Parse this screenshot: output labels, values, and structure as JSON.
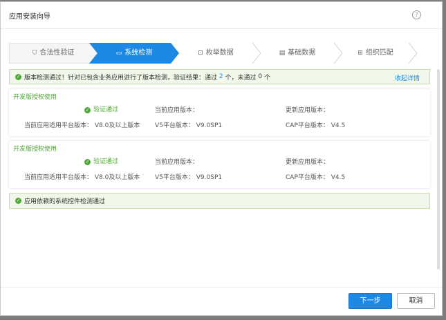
{
  "window": {
    "title": "应用安装向导"
  },
  "steps": [
    {
      "label": "合法性验证",
      "icon": "shield-icon"
    },
    {
      "label": "系统检测",
      "icon": "monitor-icon"
    },
    {
      "label": "枚举数据",
      "icon": "enum-icon"
    },
    {
      "label": "基础数据",
      "icon": "list-icon"
    },
    {
      "label": "组织匹配",
      "icon": "org-icon"
    }
  ],
  "alert_top": {
    "prefix": "版本检测通过！针对已包含业务应用进行了版本检测，验证结果：通过",
    "passed": "2",
    "middle": "个，未通过",
    "failed": "0",
    "suffix": "个",
    "link": "收起详情"
  },
  "cards": [
    {
      "tag": "开发版授权使用",
      "status": "验证通过",
      "current_label": "当前应用版本：",
      "update_label": "更新应用版本：",
      "platform_label": "当前应用适用平台版本：",
      "platform_value": "V8.0及以上版本",
      "v5_label": "V5平台版本：",
      "v5_value": "V9.0SP1",
      "cap_label": "CAP平台版本：",
      "cap_value": "V4.5"
    },
    {
      "tag": "开发版授权使用",
      "status": "验证通过",
      "current_label": "当前应用版本：",
      "update_label": "更新应用版本：",
      "platform_label": "当前应用适用平台版本：",
      "platform_value": "V8.0及以上版本",
      "v5_label": "V5平台版本：",
      "v5_value": "V9.0SP1",
      "cap_label": "CAP平台版本：",
      "cap_value": "V4.5"
    }
  ],
  "alert_bottom": {
    "text": "应用依赖的系统控件检测通过"
  },
  "buttons": {
    "next": "下一步",
    "cancel": "取消"
  },
  "colors": {
    "accent": "#1e88e5",
    "success": "#52a739",
    "alert_bg": "#f1f8e9"
  }
}
